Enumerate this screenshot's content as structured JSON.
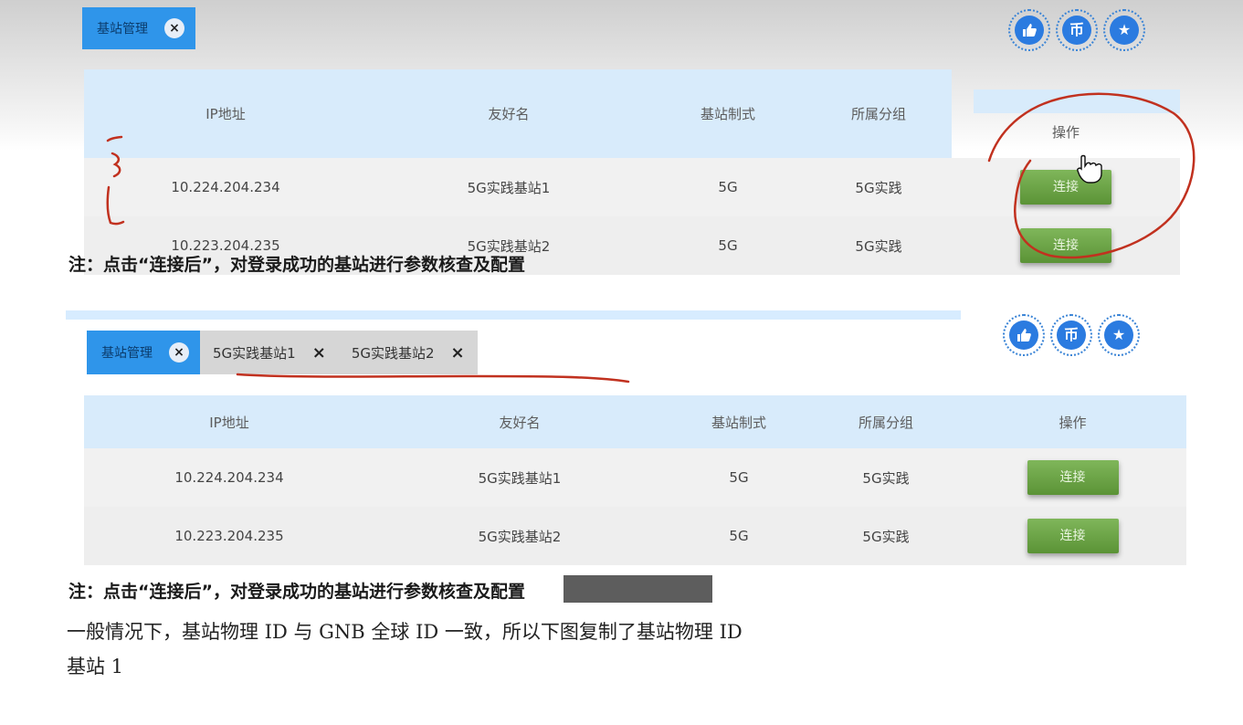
{
  "panels": [
    {
      "tabs": [
        {
          "label": "基站管理",
          "active": true
        }
      ],
      "columns": [
        "IP地址",
        "友好名",
        "基站制式",
        "所属分组",
        "操作"
      ],
      "rows": [
        {
          "ip": "10.224.204.234",
          "name": "5G实践基站1",
          "mode": "5G",
          "group": "5G实践",
          "action": "连接"
        },
        {
          "ip": "10.223.204.235",
          "name": "5G实践基站2",
          "mode": "5G",
          "group": "5G实践",
          "action": "连接"
        }
      ],
      "note": "注：点击“连接后”，对登录成功的基站进行参数核查及配置"
    },
    {
      "tabs": [
        {
          "label": "基站管理",
          "active": true
        },
        {
          "label": "5G实践基站1",
          "active": false
        },
        {
          "label": "5G实践基站2",
          "active": false
        }
      ],
      "columns": [
        "IP地址",
        "友好名",
        "基站制式",
        "所属分组",
        "操作"
      ],
      "rows": [
        {
          "ip": "10.224.204.234",
          "name": "5G实践基站1",
          "mode": "5G",
          "group": "5G实践",
          "action": "连接"
        },
        {
          "ip": "10.223.204.235",
          "name": "5G实践基站2",
          "mode": "5G",
          "group": "5G实践",
          "action": "连接"
        }
      ],
      "note": "注：点击“连接后”，对登录成功的基站进行参数核查及配置"
    }
  ],
  "social_icons": [
    "thumbs-up-icon",
    "coin-icon",
    "star-icon"
  ],
  "social_glyphs": {
    "coin": "币"
  },
  "doc_lines": [
    "一般情况下，基站物理 ID 与 GNB 全球 ID 一致，所以下图复制了基站物理 ID",
    "基站 1"
  ],
  "colors": {
    "tab_active": "#2f95ea",
    "header_bg": "#d8ebfb",
    "connect_button": "#6aa544",
    "annotation_ink": "#c1311f"
  }
}
